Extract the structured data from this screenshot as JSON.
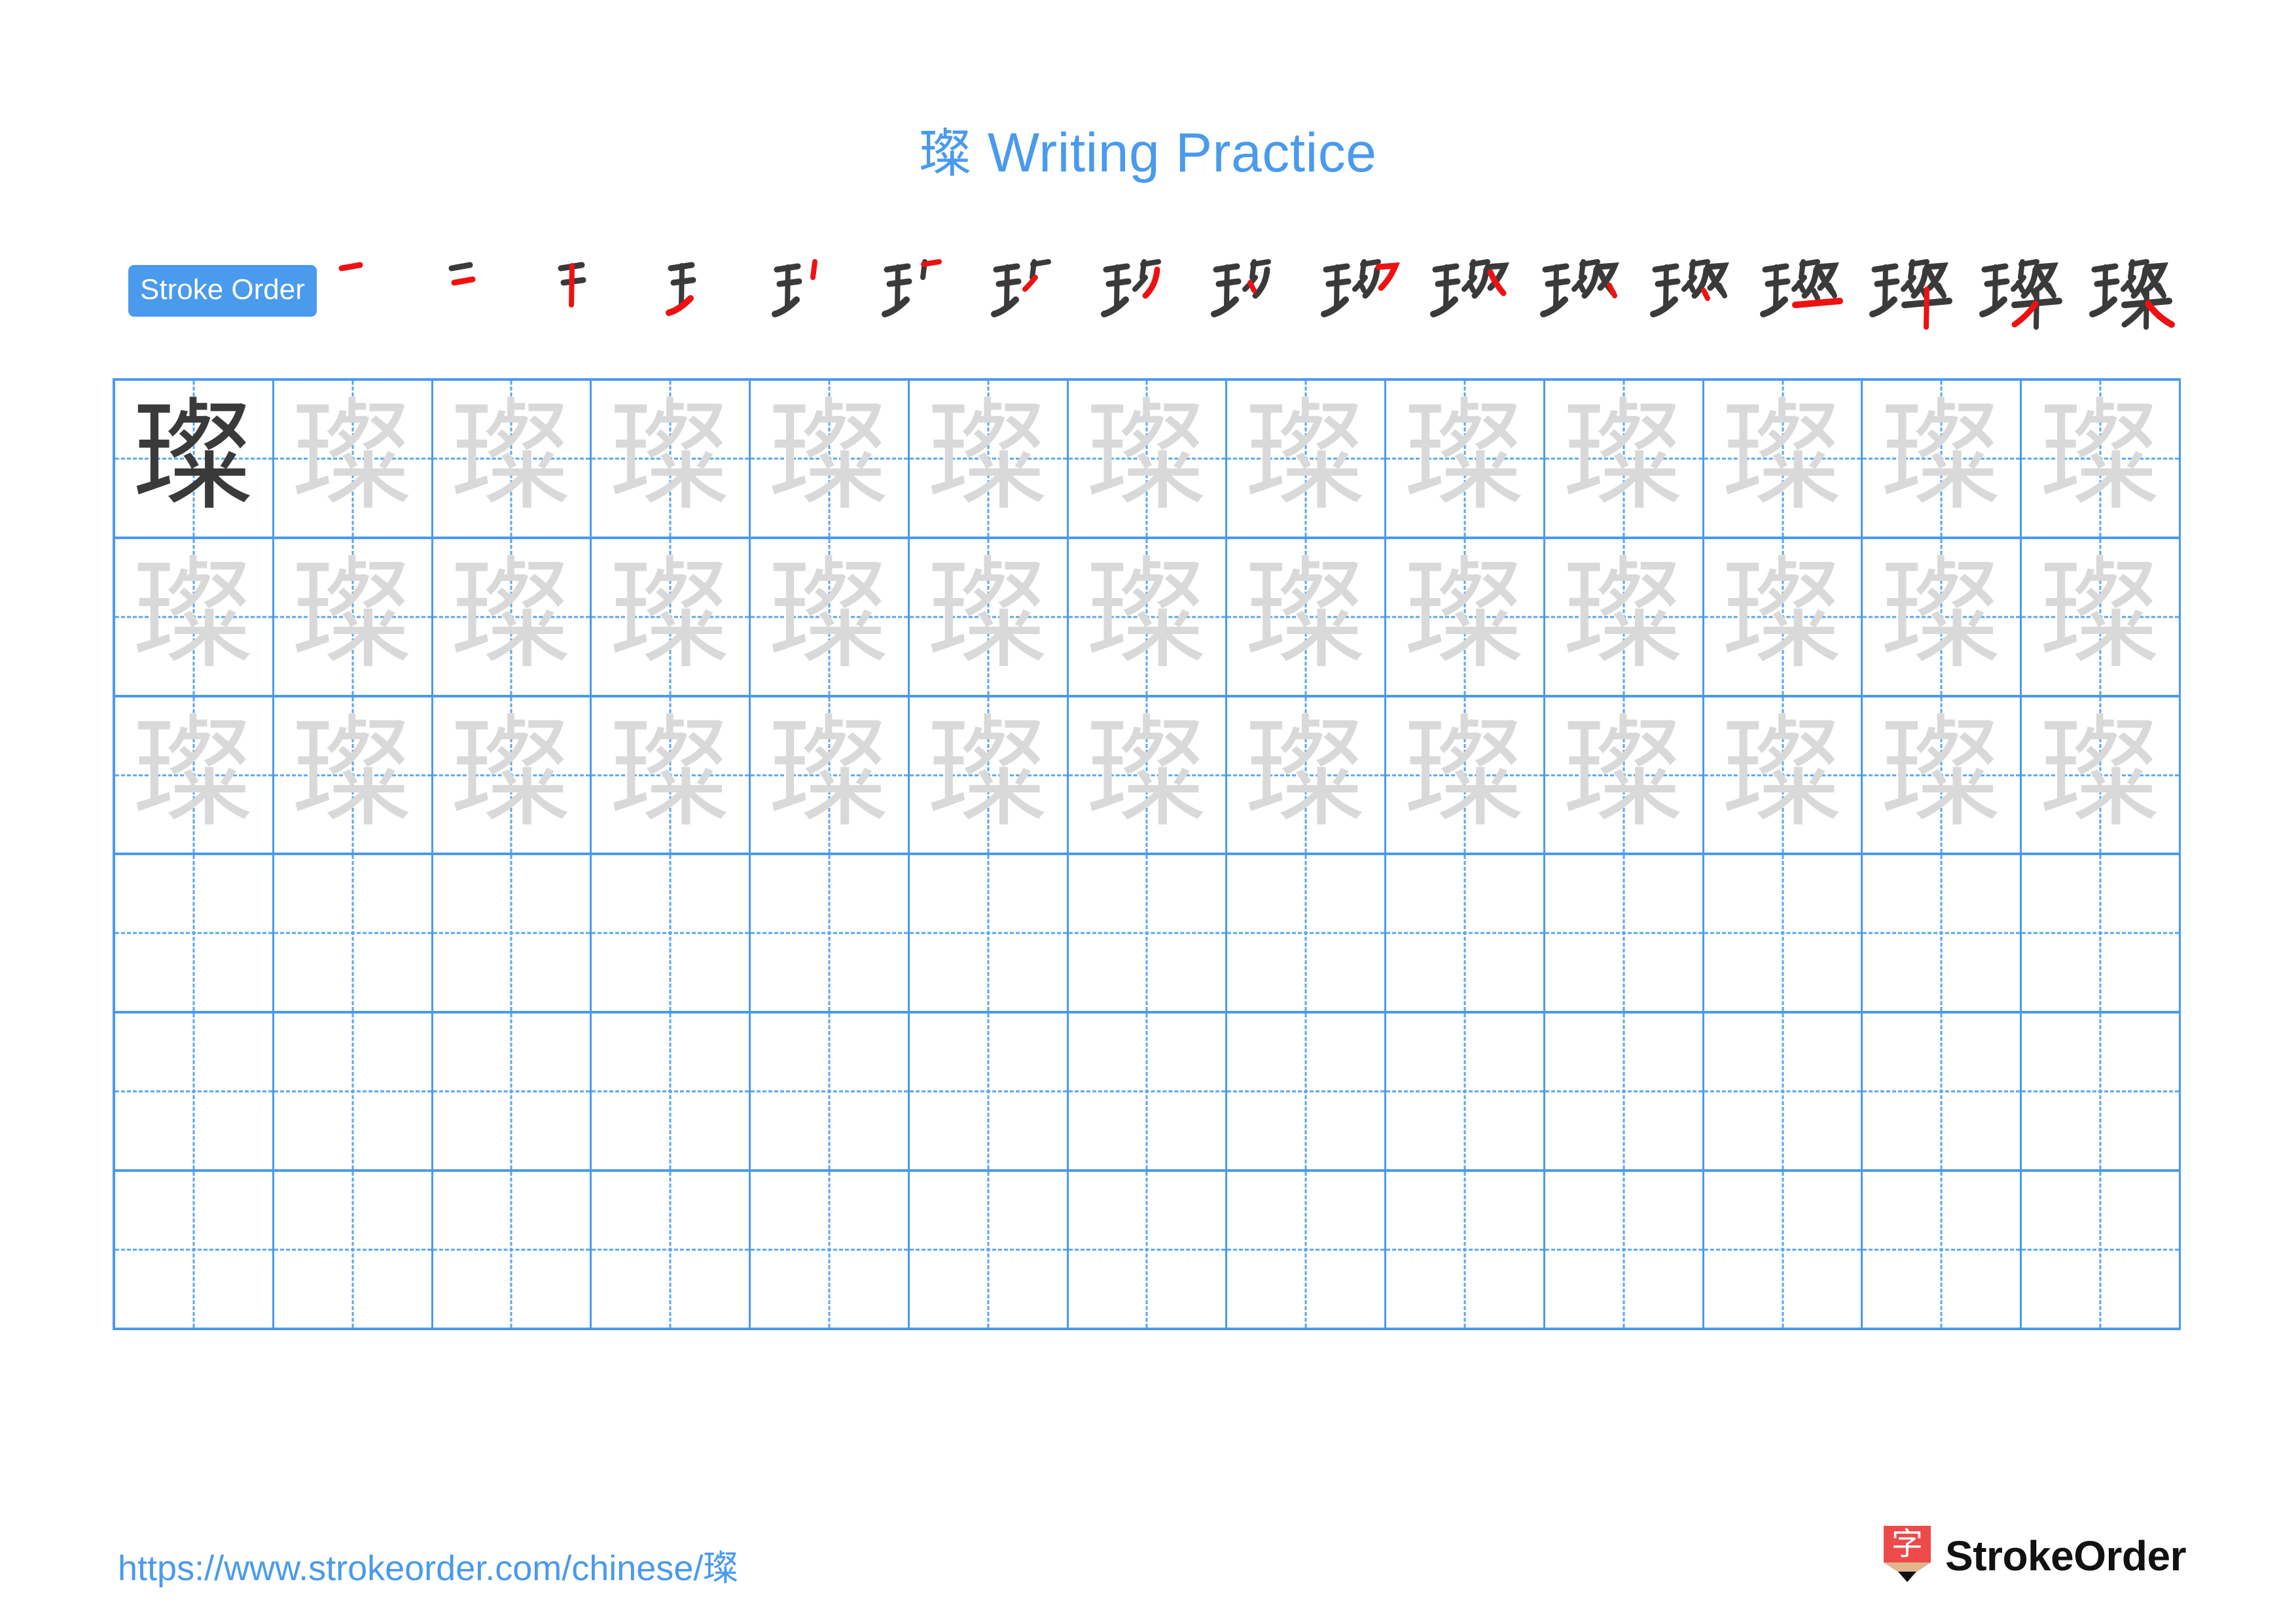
{
  "document": {
    "character": "璨",
    "title_suffix": " Writing Practice",
    "title_full": "璨 Writing Practice",
    "title_color": "#4a9aed"
  },
  "stroke_order": {
    "label": "Stroke Order",
    "badge_bg": "#4a9aed",
    "badge_text_color": "#ffffff",
    "total_strokes": 17,
    "new_stroke_color": "#ee1111",
    "prev_stroke_color": "#3a3a3a",
    "steps": [
      {
        "index": 1,
        "strokes_shown": 1,
        "new_stroke": "héng (horizontal)"
      },
      {
        "index": 2,
        "strokes_shown": 2,
        "new_stroke": "héng (horizontal)"
      },
      {
        "index": 3,
        "strokes_shown": 3,
        "new_stroke": "shù (vertical)"
      },
      {
        "index": 4,
        "strokes_shown": 4,
        "new_stroke": "tí (rising)"
      },
      {
        "index": 5,
        "strokes_shown": 5,
        "new_stroke": "shù (vertical)"
      },
      {
        "index": 6,
        "strokes_shown": 6,
        "new_stroke": "héng-piě"
      },
      {
        "index": 7,
        "strokes_shown": 7,
        "new_stroke": "piě (left-falling)"
      },
      {
        "index": 8,
        "strokes_shown": 8,
        "new_stroke": "piě (left-falling)"
      },
      {
        "index": 9,
        "strokes_shown": 9,
        "new_stroke": "diǎn (dot)"
      },
      {
        "index": 10,
        "strokes_shown": 10,
        "new_stroke": "héng-zhé"
      },
      {
        "index": 11,
        "strokes_shown": 11,
        "new_stroke": "piě (left-falling)"
      },
      {
        "index": 12,
        "strokes_shown": 12,
        "new_stroke": "nà (right-falling)"
      },
      {
        "index": 13,
        "strokes_shown": 13,
        "new_stroke": "diǎn (dot)"
      },
      {
        "index": 14,
        "strokes_shown": 14,
        "new_stroke": "héng (horizontal)"
      },
      {
        "index": 15,
        "strokes_shown": 15,
        "new_stroke": "shù (vertical)"
      },
      {
        "index": 16,
        "strokes_shown": 16,
        "new_stroke": "piě (left-falling)"
      },
      {
        "index": 17,
        "strokes_shown": 17,
        "new_stroke": "nà (right-falling)"
      }
    ]
  },
  "practice_grid": {
    "columns": 13,
    "rows": 6,
    "border_color": "#4a9aed",
    "guide_color": "#5aa6f0",
    "dark_color": "#3a3a3a",
    "trace_color": "#d9d9d9",
    "row_fill": [
      {
        "row": 1,
        "filled": 13,
        "first_cell_style": "dark",
        "other_cells_style": "trace"
      },
      {
        "row": 2,
        "filled": 13,
        "first_cell_style": "trace",
        "other_cells_style": "trace"
      },
      {
        "row": 3,
        "filled": 13,
        "first_cell_style": "trace",
        "other_cells_style": "trace"
      },
      {
        "row": 4,
        "filled": 0,
        "first_cell_style": "empty",
        "other_cells_style": "empty"
      },
      {
        "row": 5,
        "filled": 0,
        "first_cell_style": "empty",
        "other_cells_style": "empty"
      },
      {
        "row": 6,
        "filled": 0,
        "first_cell_style": "empty",
        "other_cells_style": "empty"
      }
    ]
  },
  "footer": {
    "url": "https://www.strokeorder.com/chinese/璨",
    "url_color": "#4a9aed",
    "brand_name": "StrokeOrder",
    "logo_character": "字",
    "logo_body_color": "#ef4a4a",
    "logo_wood_color": "#e2b58e",
    "logo_tip_color": "#111111"
  }
}
